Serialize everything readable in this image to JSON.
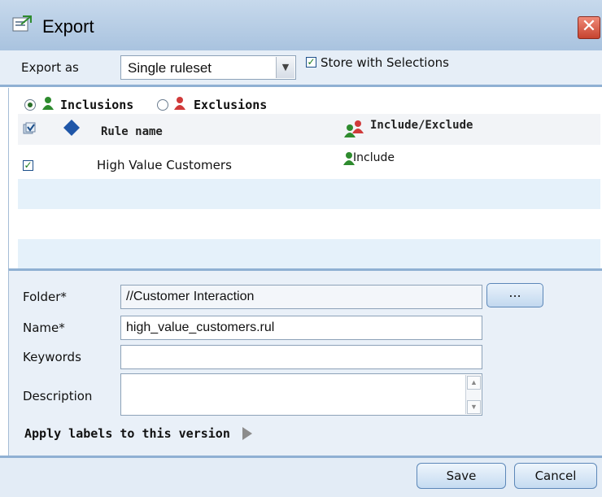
{
  "window": {
    "title": "Export"
  },
  "export_as": {
    "label": "Export as",
    "selected": "Single ruleset",
    "store_with_selections": {
      "label": "Store with Selections",
      "checked": true
    }
  },
  "filter": {
    "inclusions_label": "Inclusions",
    "exclusions_label": "Exclusions",
    "selected": "Inclusions"
  },
  "table": {
    "columns": {
      "rule_name": "Rule name",
      "include_exclude": "Include/Exclude"
    },
    "rows": [
      {
        "checked": true,
        "rule_name": "High Value Customers",
        "include_exclude": "Include"
      }
    ]
  },
  "form": {
    "folder_label": "Folder*",
    "folder_value": "//Customer Interaction",
    "browse_label": "...",
    "name_label": "Name*",
    "name_value": "high_value_customers.rul",
    "keywords_label": "Keywords",
    "keywords_value": "",
    "description_label": "Description",
    "description_value": "",
    "apply_labels": "Apply labels to this version"
  },
  "buttons": {
    "save": "Save",
    "cancel": "Cancel"
  },
  "colors": {
    "include_icon": "#2e8b2e",
    "exclude_icon": "#d03a3a",
    "accent": "#8fb0d3"
  }
}
